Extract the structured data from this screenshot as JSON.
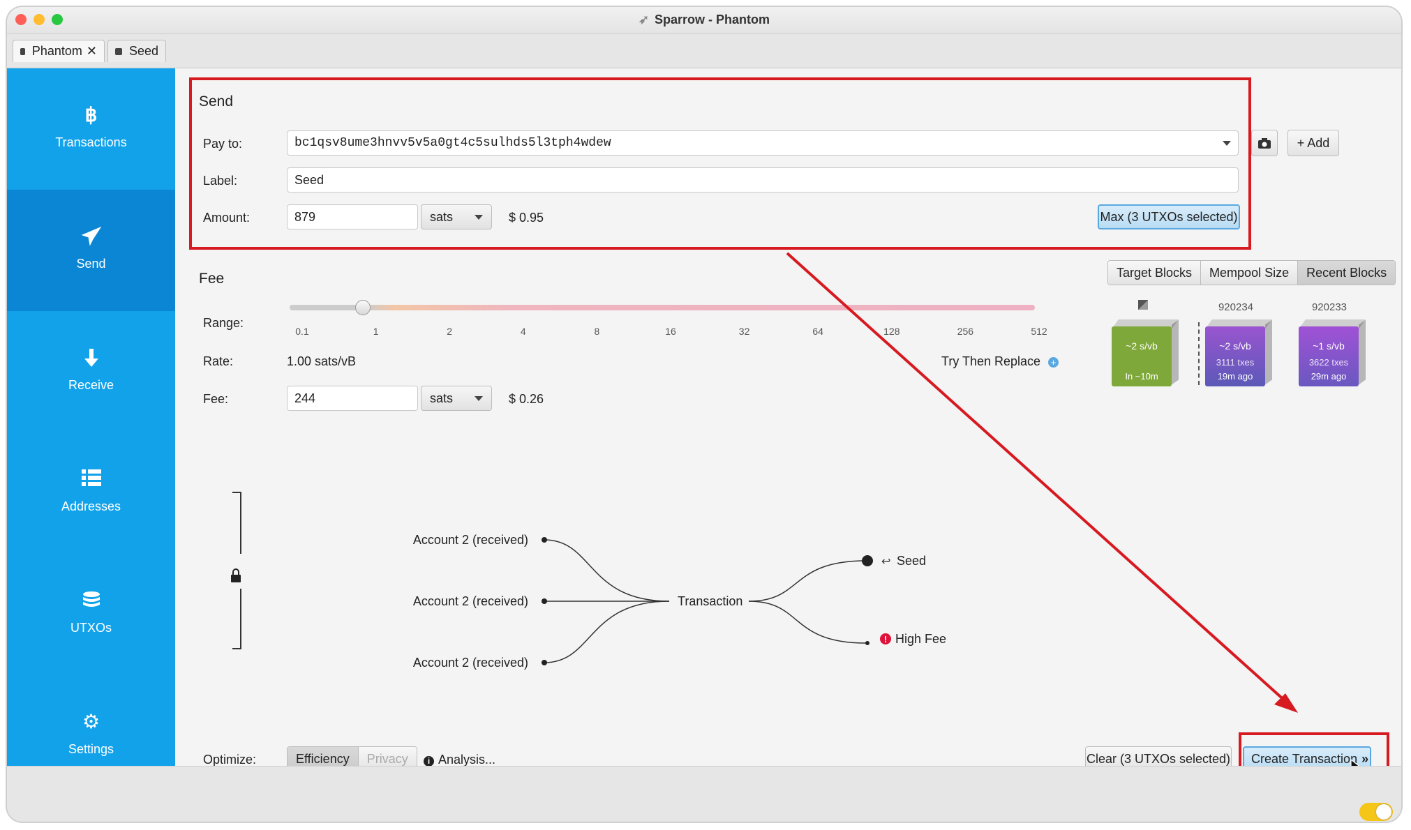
{
  "window": {
    "title": "Sparrow - Phantom"
  },
  "tabs": [
    {
      "label": "Phantom",
      "active": true,
      "closable": true
    },
    {
      "label": "Seed",
      "active": false
    }
  ],
  "sidebar": {
    "items": [
      {
        "label": "Transactions",
        "icon": "bitcoin-icon"
      },
      {
        "label": "Send",
        "icon": "paper-plane-icon",
        "active": true
      },
      {
        "label": "Receive",
        "icon": "arrow-down-icon"
      },
      {
        "label": "Addresses",
        "icon": "list-icon"
      },
      {
        "label": "UTXOs",
        "icon": "coins-icon"
      },
      {
        "label": "Settings",
        "icon": "gear-icon"
      }
    ]
  },
  "send": {
    "title": "Send",
    "pay_to_label": "Pay to:",
    "pay_to_value": "bc1qsv8ume3hnvv5v5a0gt4c5sulhds5l3tph4wdew",
    "scan_icon": "camera-icon",
    "add_label": "+ Add",
    "label_label": "Label:",
    "label_value": "Seed",
    "amount_label": "Amount:",
    "amount_value": "879",
    "amount_unit": "sats",
    "amount_fiat": "$ 0.95",
    "max_label": "Max (3 UTXOs selected)"
  },
  "fee": {
    "title": "Fee",
    "range_label": "Range:",
    "slider_ticks": [
      "0.1",
      "1",
      "2",
      "4",
      "8",
      "16",
      "32",
      "64",
      "128",
      "256",
      "512"
    ],
    "slider_value_tick_index": 1,
    "rate_label": "Rate:",
    "rate_value": "1.00 sats/vB",
    "try_replace_label": "Try Then Replace",
    "fee_label": "Fee:",
    "fee_value": "244",
    "fee_unit": "sats",
    "fee_fiat": "$ 0.26",
    "view_tabs": [
      "Target Blocks",
      "Mempool Size",
      "Recent Blocks"
    ],
    "view_selected": "Recent Blocks",
    "blocks": [
      {
        "number": "",
        "rate": "~2 s/vb",
        "txes": "",
        "time": "In ~10m",
        "color": "#7fa83a"
      },
      {
        "number": "920234",
        "rate": "~2 s/vb",
        "txes": "3111 txes",
        "time": "19m ago",
        "color": "#7a4fc2"
      },
      {
        "number": "920233",
        "rate": "~1 s/vb",
        "txes": "3622 txes",
        "time": "29m ago",
        "color": "#8a4fcf"
      }
    ]
  },
  "diagram": {
    "inputs": [
      "Account 2 (received)",
      "Account 2 (received)",
      "Account 2 (received)"
    ],
    "center": "Transaction",
    "outputs": [
      "Seed",
      "High Fee"
    ]
  },
  "footer": {
    "optimize_label": "Optimize:",
    "optimize_options": [
      "Efficiency",
      "Privacy"
    ],
    "optimize_selected": "Efficiency",
    "analysis_label": "Analysis...",
    "clear_label": "Clear (3 UTXOs selected)",
    "create_label": "Create Transaction"
  },
  "colors": {
    "sidebar": "#11a2ea",
    "highlight": "#d71920",
    "high_fee": "#e0123a"
  }
}
